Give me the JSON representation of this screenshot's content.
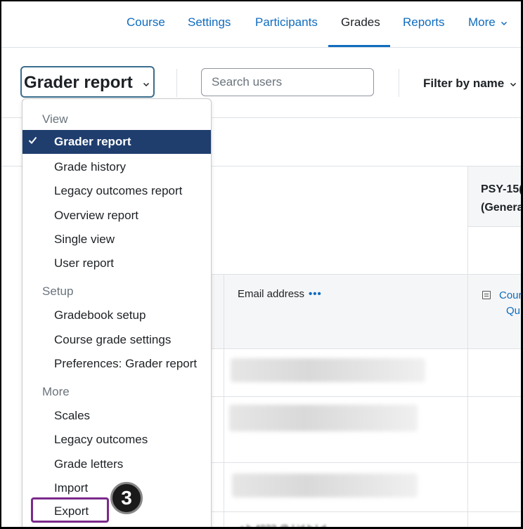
{
  "nav": {
    "tabs": [
      {
        "label": "Course"
      },
      {
        "label": "Settings"
      },
      {
        "label": "Participants"
      },
      {
        "label": "Grades",
        "active": true
      },
      {
        "label": "Reports"
      },
      {
        "label": "More"
      }
    ]
  },
  "action_bar": {
    "report_select": "Grader report",
    "search_placeholder": "Search users",
    "filter_label": "Filter by name"
  },
  "table": {
    "email_header": "Email address",
    "more_dots": "•••",
    "course_item_line1": "PSY-15(",
    "course_item_line2": "(Genera",
    "grade_item_line1": "Cour",
    "grade_item_line2": "Qui",
    "partial_row": "r  h  4022 @ l  id   h  l  d"
  },
  "menu": {
    "view_heading": "View",
    "selected": "Grader report",
    "view_items": [
      "Grade history",
      "Legacy outcomes report",
      "Overview report",
      "Single view",
      "User report"
    ],
    "setup_heading": "Setup",
    "setup_items": [
      "Gradebook setup",
      "Course grade settings",
      "Preferences: Grader report"
    ],
    "more_heading": "More",
    "more_items": [
      "Scales",
      "Legacy outcomes",
      "Grade letters",
      "Import"
    ],
    "export_label": "Export"
  },
  "callout": {
    "number": "3",
    "color": "#7b2a8c"
  },
  "colors": {
    "accent": "#0f6cbf",
    "selected_bg": "#1f3e6e"
  }
}
